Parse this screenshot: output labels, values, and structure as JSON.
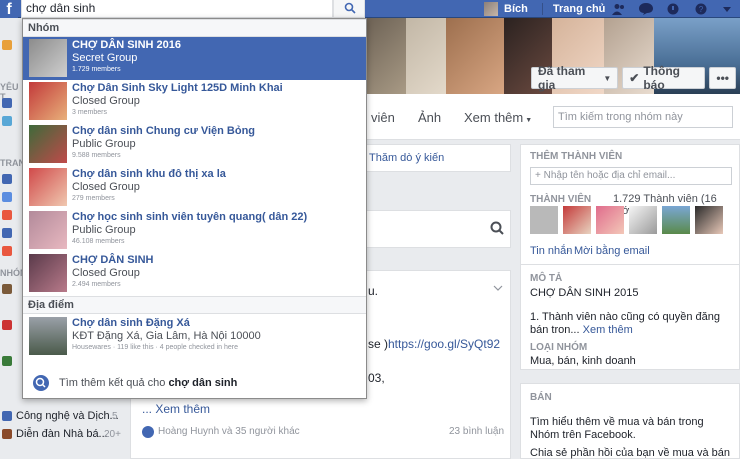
{
  "search": {
    "value": "chợ dân sinh"
  },
  "topbar": {
    "logo": "f",
    "user_name": "Bích",
    "home_label": "Trang chủ"
  },
  "cover_actions": {
    "joined": "Đã tham gia",
    "notifications": "Thông báo",
    "more": "•••"
  },
  "tabs": {
    "videos": "viên",
    "photos": "Ảnh",
    "more": "Xem thêm",
    "search_placeholder": "Tìm kiếm trong nhóm này"
  },
  "feed": {
    "poll": "Thăm dò ý kiến",
    "post_fragments": [
      "u.",
      "se ) ",
      "https://goo.gl/SyQt92",
      "03,",
      "... Xem thêm"
    ],
    "likes": "Hoàng Huynh và 35 người khác",
    "comments": "23 bình luận"
  },
  "left_sidebar": {
    "headers": [
      "YÊU T",
      "TRAN",
      "NHÓN"
    ],
    "items": [
      {
        "label": "Công nghệ và Dịch...",
        "count": "5"
      },
      {
        "label": "Diễn đàn Nhà bá...",
        "count": "20+"
      }
    ]
  },
  "right": {
    "add_member_title": "THÊM THÀNH VIÊN",
    "add_member_placeholder": "+ Nhập tên hoặc địa chỉ email...",
    "members_title": "THÀNH VIÊN",
    "members_count": "1.729 Thành viên (16 mới)",
    "messages_link": "Tin nhắn",
    "invite_link": "Mời bằng email",
    "desc_title": "MÔ TẢ",
    "desc_name": "CHỢ DÂN SINH 2015",
    "desc_rule": "1. Thành viên nào cũng có quyền đăng bán tron...",
    "desc_more": "Xem thêm",
    "group_type_title": "LOẠI NHÓM",
    "group_type": "Mua, bán, kinh doanh",
    "sell_title": "BÁN",
    "sell_text1": "Tìm hiểu thêm về mua và bán trong Nhóm trên Facebook.",
    "sell_text2": "Chia sẻ phần hồi của bạn về mua và bán"
  },
  "dropdown": {
    "groups_header": "Nhóm",
    "groups": [
      {
        "name": "CHỢ DÂN SINH 2016",
        "type": "Secret Group",
        "meta": "1.729 members",
        "active": true
      },
      {
        "name": "Chợ Dân Sinh Sky Light 125D Minh Khai",
        "type": "Closed Group",
        "meta": "3 members"
      },
      {
        "name": "Chợ dân sinh Chung cư Viện Bỏng",
        "type": "Public Group",
        "meta": "9.588 members"
      },
      {
        "name": "Chợ dân sinh khu đô thị xa la",
        "type": "Closed Group",
        "meta": "279 members"
      },
      {
        "name": "Chợ học sinh sinh viên tuyên quang( dân 22)",
        "type": "Public Group",
        "meta": "46.108 members"
      },
      {
        "name": "CHỢ DÂN SINH",
        "type": "Closed Group",
        "meta": "2.494 members"
      }
    ],
    "places_header": "Địa điểm",
    "place": {
      "name": "Chợ dân sinh Đặng Xá",
      "address": "KĐT Đặng Xá, Gia Lâm, Hà Nội 10000",
      "meta": "Housewares · 119 like this · 4 people checked in here"
    },
    "more_prefix": "Tìm thêm kết quả cho ",
    "more_query": "chợ dân sinh"
  }
}
